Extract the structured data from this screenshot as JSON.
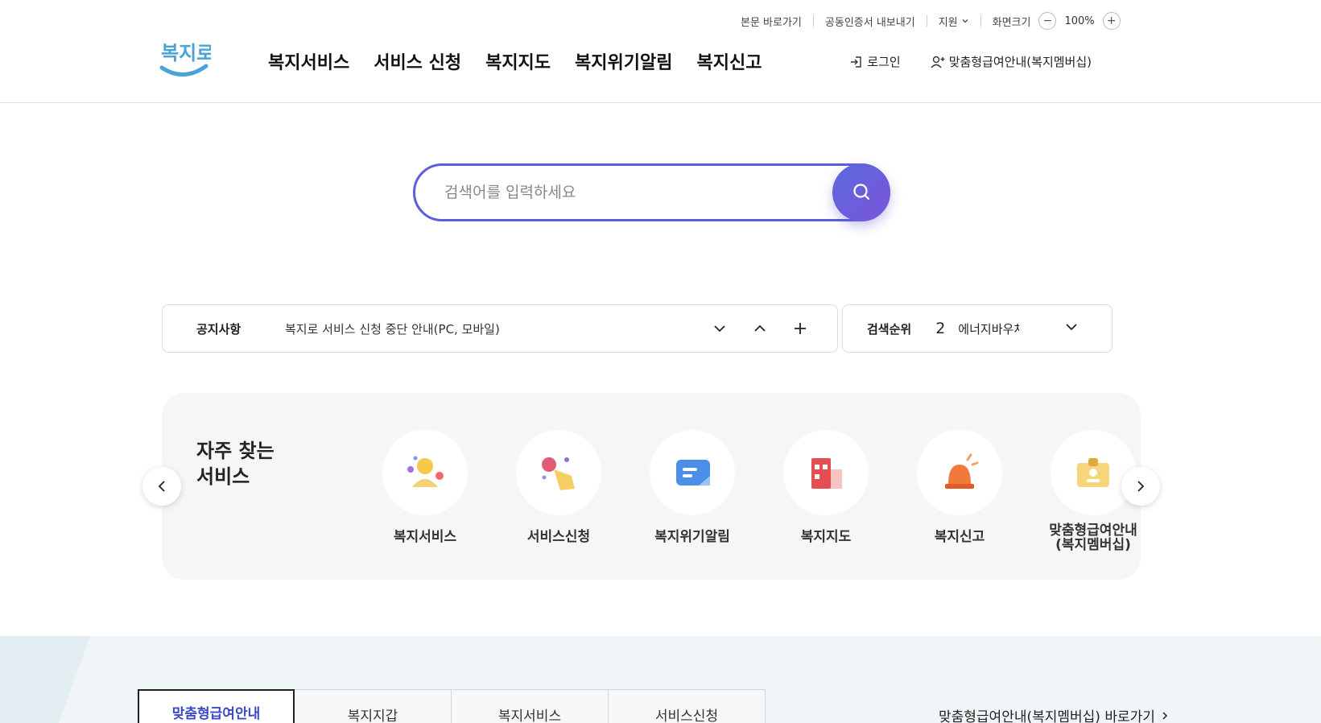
{
  "utility": {
    "skip_to_content": "본문 바로가기",
    "export_cert": "공동인증서 내보내기",
    "support": "지원",
    "zoom_label": "화면크기",
    "zoom_minus": "−",
    "zoom_value": "100%",
    "zoom_plus": "+"
  },
  "header": {
    "logo_text": "복지로",
    "nav": [
      "복지서비스",
      "서비스 신청",
      "복지지도",
      "복지위기알림",
      "복지신고"
    ],
    "login": "로그인",
    "membership": "맞춤형급여안내(복지멤버십)"
  },
  "search": {
    "placeholder": "검색어를 입력하세요"
  },
  "notice": {
    "label": "공지사항",
    "text": "복지로 서비스 신청 중단 안내(PC, 모바일)"
  },
  "rank": {
    "label": "검색순위",
    "number": "2",
    "keyword": "에너지바우처"
  },
  "frequent": {
    "title_line1": "자주 찾는",
    "title_line2": "서비스",
    "items": [
      {
        "label": "복지서비스",
        "icon": "person-icon"
      },
      {
        "label": "서비스신청",
        "icon": "hand-click-icon"
      },
      {
        "label": "복지위기알림",
        "icon": "message-icon"
      },
      {
        "label": "복지지도",
        "icon": "building-icon"
      },
      {
        "label": "복지신고",
        "icon": "siren-icon"
      },
      {
        "label_line1": "맞춤형급여안내",
        "label_line2": "(복지멤버십)",
        "icon": "id-badge-icon"
      }
    ]
  },
  "bottom": {
    "tabs": [
      "맞춤형급여안내",
      "복지지갑",
      "복지서비스",
      "서비스신청"
    ],
    "link": "맞춤형급여안내(복지멤버십) 바로가기"
  },
  "colors": {
    "accent": "#5b5fdc",
    "accent_dark": "#3c49c8"
  }
}
